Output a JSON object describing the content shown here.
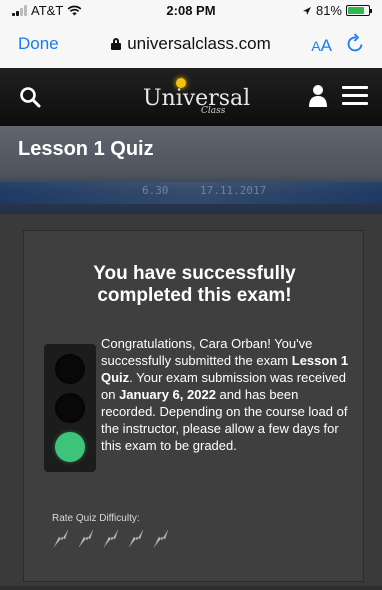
{
  "status_bar": {
    "carrier": "AT&T",
    "time": "2:08 PM",
    "battery_text": "81%",
    "battery_level": 0.81,
    "battery_color": "#2db84b"
  },
  "browser": {
    "done_label": "Done",
    "url": "universalclass.com",
    "aa_small": "A",
    "aa_large": "A",
    "icons": [
      "lock-icon",
      "reload-icon"
    ],
    "accent_color": "#1a7cf5"
  },
  "site_header": {
    "logo_text": "Universal",
    "logo_sub": "Class",
    "icons": [
      "search-icon",
      "user-icon",
      "menu-icon"
    ]
  },
  "hero": {
    "title": "Lesson 1 Quiz",
    "ticker_left": "6.30",
    "ticker_right": "17.11.2017"
  },
  "card": {
    "heading_line1": "You have successfully",
    "heading_line2": "completed this exam!",
    "message": {
      "intro": "Congratulations, Cara Orban! You've successfully submitted the exam ",
      "exam_name": "Lesson 1 Quiz",
      "middle": ". Your exam submission was received on ",
      "date": "January 6, 2022",
      "end": " and has been recorded. Depending on the course load of the instructor, please allow a few days for this exam to be graded."
    },
    "traffic_light": {
      "active": "green",
      "green_color": "#3ec37a"
    },
    "rate_label": "Rate Quiz Difficulty:",
    "rating_icons_count": 5
  }
}
